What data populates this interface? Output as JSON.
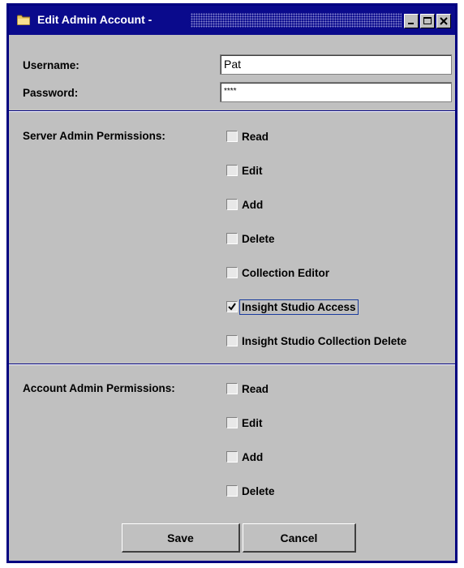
{
  "window": {
    "title": "Edit Admin Account -",
    "minimize_icon": "minimize-icon",
    "maximize_icon": "maximize-icon",
    "close_icon": "close-icon",
    "title_color": "#0a0a8c"
  },
  "form": {
    "username_label": "Username:",
    "username_value": "Pat",
    "password_label": "Password:",
    "password_value": "****"
  },
  "server_permissions": {
    "label": "Server Admin Permissions:",
    "items": [
      {
        "label": "Read",
        "checked": false
      },
      {
        "label": "Edit",
        "checked": false
      },
      {
        "label": "Add",
        "checked": false
      },
      {
        "label": "Delete",
        "checked": false
      },
      {
        "label": "Collection Editor",
        "checked": false
      },
      {
        "label": "Insight Studio Access",
        "checked": true
      },
      {
        "label": "Insight Studio Collection Delete",
        "checked": false
      }
    ]
  },
  "account_permissions": {
    "label": "Account Admin Permissions:",
    "items": [
      {
        "label": "Read",
        "checked": false
      },
      {
        "label": "Edit",
        "checked": false
      },
      {
        "label": "Add",
        "checked": false
      },
      {
        "label": "Delete",
        "checked": false
      }
    ]
  },
  "buttons": {
    "save_label": "Save",
    "cancel_label": "Cancel"
  }
}
